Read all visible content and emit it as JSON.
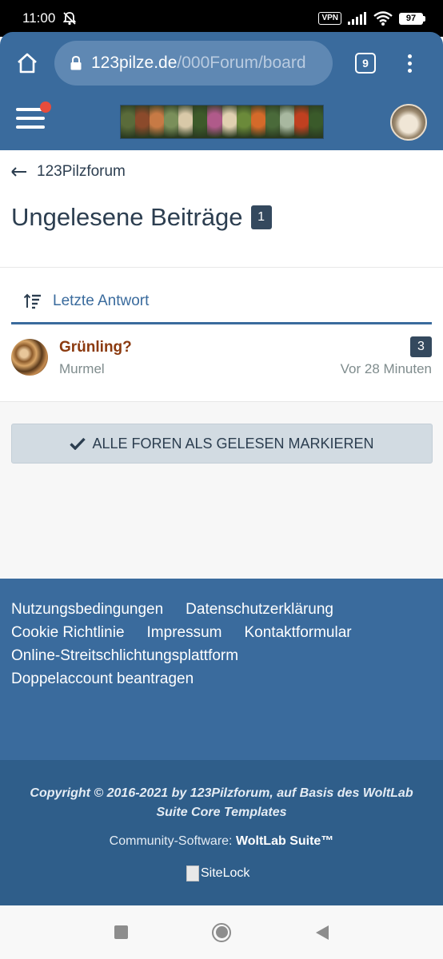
{
  "status_bar": {
    "time": "11:00",
    "vpn": "VPN",
    "battery": "97"
  },
  "browser": {
    "url_host": "123pilze.de",
    "url_path": "/000Forum/board",
    "tab_count": "9"
  },
  "site_header": {
    "banner_colors": [
      "#5a6b3a",
      "#8b4a2b",
      "#c77a45",
      "#7a8f5a",
      "#d9c9a8",
      "#3d5a2a",
      "#b05a8a",
      "#e0d0b0",
      "#6b8a3a",
      "#d46a2a",
      "#4a6a3a",
      "#a8b8a0",
      "#c04020",
      "#3a5a2a"
    ],
    "has_notification": true
  },
  "breadcrumb": {
    "label": "123Pilzforum"
  },
  "page": {
    "title": "Ungelesene Beiträge",
    "count": "1"
  },
  "sort": {
    "label": "Letzte Antwort"
  },
  "threads": [
    {
      "title": "Grünling?",
      "author": "Murmel",
      "replies": "3",
      "time": "Vor 28 Minuten"
    }
  ],
  "actions": {
    "mark_all_read": "ALLE FOREN ALS GELESEN MARKIEREN"
  },
  "footer": {
    "links": [
      "Nutzungsbedingungen",
      "Datenschutzerklärung",
      "Cookie Richtlinie",
      "Impressum",
      "Kontaktformular",
      "Online-Streitschlichtungsplattform",
      "Doppelaccount beantragen"
    ],
    "copyright": "Copyright © 2016-2021 by 123Pilzforum, auf Basis des WoltLab Suite Core Templates",
    "software_prefix": "Community-Software: ",
    "software_name": "WoltLab Suite™",
    "sitelock_alt": "SiteLock"
  },
  "colors": {
    "brand": "#3a6b9d",
    "footer_dark": "#2f5e8a",
    "thread_title": "#8b3a0f",
    "badge": "#34495e"
  }
}
